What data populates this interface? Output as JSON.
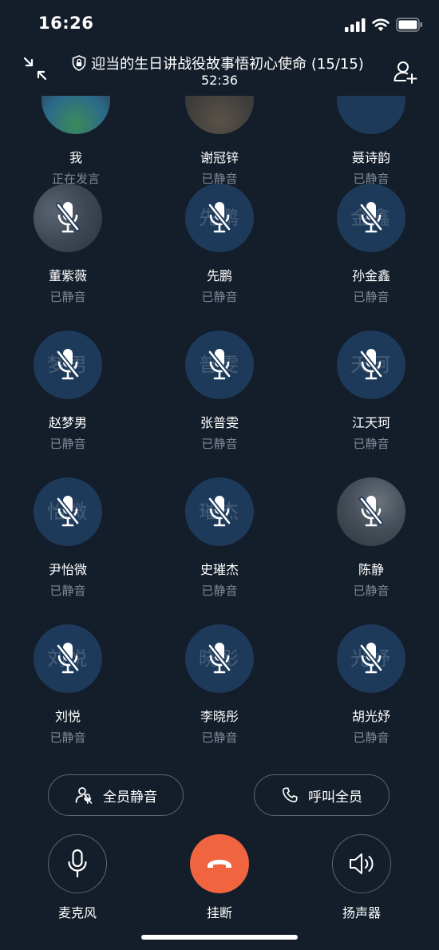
{
  "status_bar": {
    "time": "16:26"
  },
  "header": {
    "title": "迎当的生日讲战役故事悟初心使命 (15/15)",
    "timer": "52:36"
  },
  "participants": [
    {
      "name": "我",
      "status": "正在发言",
      "initials": "",
      "photo": true
    },
    {
      "name": "谢冠锌",
      "status": "已静音",
      "initials": "",
      "photo": true
    },
    {
      "name": "聂诗韵",
      "status": "已静音",
      "initials": "",
      "photo": false
    },
    {
      "name": "董紫薇",
      "status": "已静音",
      "initials": "",
      "photo": true
    },
    {
      "name": "先鹏",
      "status": "已静音",
      "initials": "先鹏",
      "photo": false
    },
    {
      "name": "孙金鑫",
      "status": "已静音",
      "initials": "金鑫",
      "photo": false
    },
    {
      "name": "赵梦男",
      "status": "已静音",
      "initials": "梦男",
      "photo": false
    },
    {
      "name": "张普雯",
      "status": "已静音",
      "initials": "普雯",
      "photo": false
    },
    {
      "name": "江天珂",
      "status": "已静音",
      "initials": "天珂",
      "photo": false
    },
    {
      "name": "尹怡微",
      "status": "已静音",
      "initials": "怡微",
      "photo": false
    },
    {
      "name": "史璀杰",
      "status": "已静音",
      "initials": "璀杰",
      "photo": false
    },
    {
      "name": "陈静",
      "status": "已静音",
      "initials": "",
      "photo": true
    },
    {
      "name": "刘悦",
      "status": "已静音",
      "initials": "刘悦",
      "photo": false
    },
    {
      "name": "李晓彤",
      "status": "已静音",
      "initials": "晓彤",
      "photo": false
    },
    {
      "name": "胡光妤",
      "status": "已静音",
      "initials": "光妤",
      "photo": false
    }
  ],
  "actions": {
    "mute_all_label": "全员静音",
    "call_all_label": "呼叫全员"
  },
  "controls": {
    "mic_label": "麦克风",
    "hangup_label": "挂断",
    "speaker_label": "扬声器"
  },
  "colors": {
    "background": "#141e2b",
    "avatar": "#1e3a5a",
    "hangup": "#f0653f",
    "muted_text": "#7d8896"
  }
}
